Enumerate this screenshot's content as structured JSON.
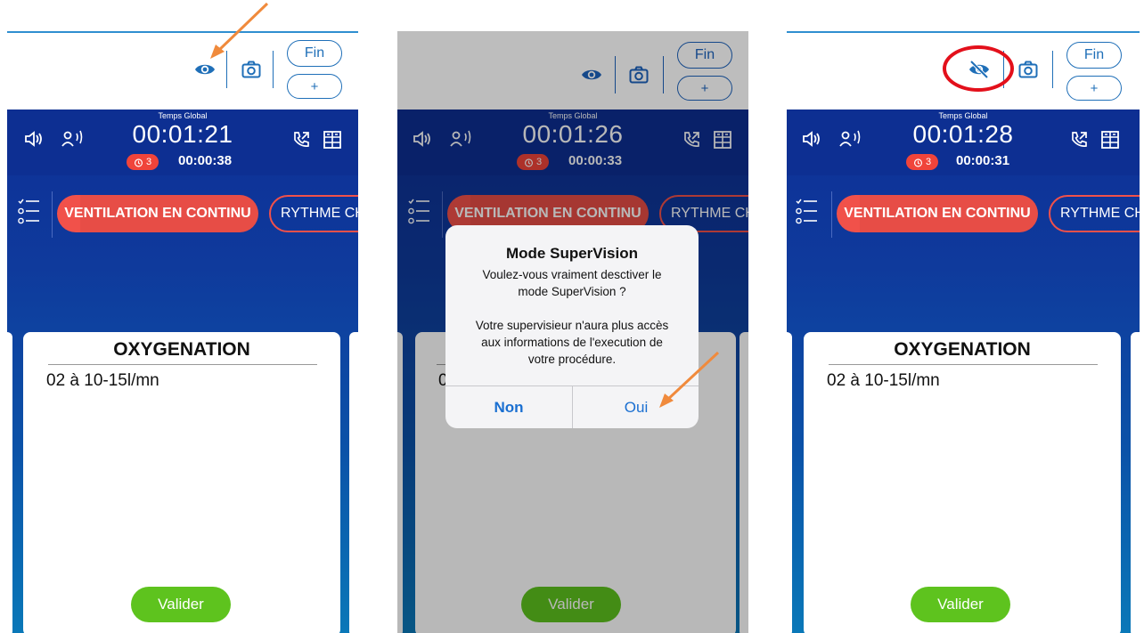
{
  "panels": [
    {
      "fin_label": "Fin",
      "plus_label": "+",
      "temps_global_label": "Temps Global",
      "global_time": "00:01:21",
      "alarm_count": "3",
      "sub_time": "00:00:38",
      "active_tab": "VENTILATION EN CONTINU",
      "next_tab": "RYTHME CH",
      "card_title": "OXYGENATION",
      "card_text": "02 à 10-15l/mn",
      "valider_label": "Valider",
      "eye_state": "visible"
    },
    {
      "fin_label": "Fin",
      "plus_label": "+",
      "temps_global_label": "Temps Global",
      "global_time": "00:01:26",
      "alarm_count": "3",
      "sub_time": "00:00:33",
      "active_tab": "VENTILATION EN CONTINU",
      "next_tab": "RYTHME CH",
      "card_text_fragment": "0",
      "valider_label": "Valider",
      "eye_state": "visible",
      "dialog": {
        "title": "Mode SuperVision",
        "line1": "Voulez-vous vraiment desctiver le",
        "line2": "mode SuperVision ?",
        "line3": "Votre supervisieur n'aura plus accès",
        "line4": "aux informations de l'execution de",
        "line5": "votre procédure.",
        "no_label": "Non",
        "yes_label": "Oui"
      }
    },
    {
      "fin_label": "Fin",
      "plus_label": "+",
      "temps_global_label": "Temps Global",
      "global_time": "00:01:28",
      "alarm_count": "3",
      "sub_time": "00:00:31",
      "active_tab": "VENTILATION EN CONTINU",
      "next_tab": "RYTHME CH",
      "card_title": "OXYGENATION",
      "card_text": "02 à 10-15l/mn",
      "valider_label": "Valider",
      "eye_state": "hidden"
    }
  ],
  "colors": {
    "brand_blue": "#0d2f92",
    "accent_red": "#f1514a",
    "valider_green": "#5ec31e",
    "ios_blue": "#1a6fd1",
    "annotation_orange": "#f08a3c",
    "annotation_ring": "#e3101b"
  }
}
